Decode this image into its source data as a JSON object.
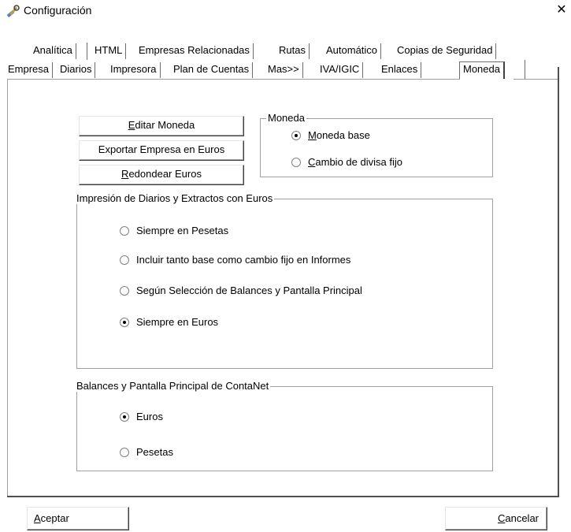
{
  "window": {
    "title": "Configuración",
    "close_glyph": "✕"
  },
  "tabs_row1": [
    {
      "label": "Analítica"
    },
    {
      "label": "HTML"
    },
    {
      "label": "Empresas Relacionadas"
    },
    {
      "label": "Rutas"
    },
    {
      "label": "Automático"
    },
    {
      "label": "Copias de Seguridad"
    }
  ],
  "tabs_row2": [
    {
      "label": "Empresa"
    },
    {
      "label": "Diarios"
    },
    {
      "label": "Impresora"
    },
    {
      "label": "Plan de Cuentas"
    },
    {
      "label": "Mas>>"
    },
    {
      "label": "IVA/IGIC"
    },
    {
      "label": "Enlaces"
    },
    {
      "label": "Moneda",
      "active": true
    }
  ],
  "buttons": {
    "editar_moneda": {
      "pre": "",
      "accel": "E",
      "post": "ditar Moneda"
    },
    "exportar": {
      "label": "Exportar Empresa en Euros"
    },
    "redondear": {
      "pre": "",
      "accel": "R",
      "post": "edondear Euros"
    }
  },
  "moneda_group": {
    "label": "Moneda",
    "options": [
      {
        "accel": "M",
        "rest": "oneda base",
        "checked": true
      },
      {
        "accel": "C",
        "rest": "ambio de divisa fijo",
        "checked": false
      }
    ]
  },
  "impresion_group": {
    "label": "Impresión de Diarios y Extractos con Euros",
    "options": [
      {
        "label": "Siempre en Pesetas",
        "checked": false
      },
      {
        "label": "Incluir tanto base como cambio fijo en Informes",
        "checked": false
      },
      {
        "label": "Según Selección de Balances y Pantalla Principal",
        "checked": false
      },
      {
        "label": "Siempre en Euros",
        "checked": true
      }
    ]
  },
  "balances_group": {
    "label": "Balances y Pantalla Principal de ContaNet",
    "options": [
      {
        "label": "Euros",
        "checked": true
      },
      {
        "label": "Pesetas",
        "checked": false
      }
    ]
  },
  "footer": {
    "aceptar": {
      "accel": "A",
      "rest": "ceptar"
    },
    "cancelar": {
      "accel": "C",
      "rest": "ancelar"
    }
  }
}
